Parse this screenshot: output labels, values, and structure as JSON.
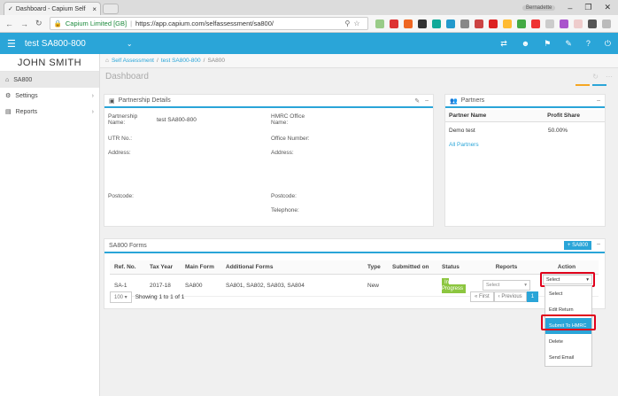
{
  "browser": {
    "tab_title": "Dashboard - Capium Self",
    "profile": "Bernadette",
    "url_secure_label": "Capium Limited [GB]",
    "url_text": "https://app.capium.com/selfassessment/sa800/"
  },
  "header": {
    "title": "test SA800-800"
  },
  "sidebar": {
    "user": "JOHN SMITH",
    "items": [
      {
        "label": "SA800"
      },
      {
        "label": "Settings"
      },
      {
        "label": "Reports"
      }
    ]
  },
  "breadcrumb": {
    "home": "Self Assessment",
    "sep": "/",
    "entity": "test SA800-800",
    "current": "SA800"
  },
  "page_title": "Dashboard",
  "partnership": {
    "title": "Partnership Details",
    "name_label": "Partnership Name:",
    "name_value": "test SA800-800",
    "utr_label": "UTR No.:",
    "address_label": "Address:",
    "postcode_label": "Postcode:",
    "hmrc_label": "HMRC Office Name:",
    "office_number_label": "Office Number:",
    "hmrc_address_label": "Address:",
    "hmrc_postcode_label": "Postcode:",
    "telephone_label": "Telephone:"
  },
  "partners": {
    "title": "Partners",
    "col_name": "Partner Name",
    "col_share": "Profit Share",
    "rows": [
      {
        "name": "Demo test",
        "share": "50.00%"
      }
    ],
    "all_link": "All Partners"
  },
  "forms": {
    "title": "SA800 Forms",
    "add_button": "+ SA800",
    "headers": [
      "Ref. No.",
      "Tax Year",
      "Main Form",
      "Additional Forms",
      "Type",
      "Submitted on",
      "Status",
      "Reports",
      "Action"
    ],
    "row": {
      "ref": "SA-1",
      "year": "2017-18",
      "main": "SA800",
      "additional": "SA801, SA802, SA803, SA804",
      "type": "New",
      "submitted": "",
      "status": "In Progress",
      "reports": "Select",
      "action": "Select"
    },
    "page_size": "100",
    "showing": "Showing 1 to 1 of 1",
    "first": "« First",
    "previous": "‹ Previous",
    "page": "1"
  },
  "action_menu": [
    "Select",
    "Edit Return",
    "Submit To HMRC",
    "Delete",
    "Send Email"
  ]
}
